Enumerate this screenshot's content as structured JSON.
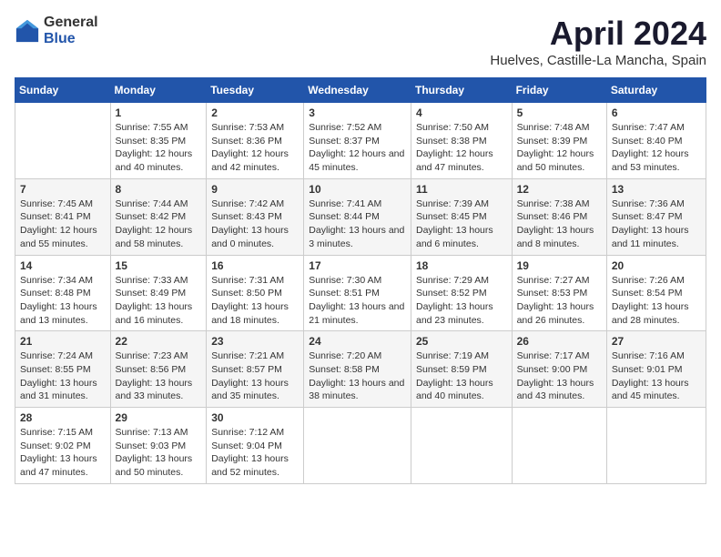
{
  "logo": {
    "general": "General",
    "blue": "Blue"
  },
  "title": "April 2024",
  "location": "Huelves, Castille-La Mancha, Spain",
  "weekdays": [
    "Sunday",
    "Monday",
    "Tuesday",
    "Wednesday",
    "Thursday",
    "Friday",
    "Saturday"
  ],
  "weeks": [
    [
      {
        "day": "",
        "sunrise": "",
        "sunset": "",
        "daylight": ""
      },
      {
        "day": "1",
        "sunrise": "Sunrise: 7:55 AM",
        "sunset": "Sunset: 8:35 PM",
        "daylight": "Daylight: 12 hours and 40 minutes."
      },
      {
        "day": "2",
        "sunrise": "Sunrise: 7:53 AM",
        "sunset": "Sunset: 8:36 PM",
        "daylight": "Daylight: 12 hours and 42 minutes."
      },
      {
        "day": "3",
        "sunrise": "Sunrise: 7:52 AM",
        "sunset": "Sunset: 8:37 PM",
        "daylight": "Daylight: 12 hours and 45 minutes."
      },
      {
        "day": "4",
        "sunrise": "Sunrise: 7:50 AM",
        "sunset": "Sunset: 8:38 PM",
        "daylight": "Daylight: 12 hours and 47 minutes."
      },
      {
        "day": "5",
        "sunrise": "Sunrise: 7:48 AM",
        "sunset": "Sunset: 8:39 PM",
        "daylight": "Daylight: 12 hours and 50 minutes."
      },
      {
        "day": "6",
        "sunrise": "Sunrise: 7:47 AM",
        "sunset": "Sunset: 8:40 PM",
        "daylight": "Daylight: 12 hours and 53 minutes."
      }
    ],
    [
      {
        "day": "7",
        "sunrise": "Sunrise: 7:45 AM",
        "sunset": "Sunset: 8:41 PM",
        "daylight": "Daylight: 12 hours and 55 minutes."
      },
      {
        "day": "8",
        "sunrise": "Sunrise: 7:44 AM",
        "sunset": "Sunset: 8:42 PM",
        "daylight": "Daylight: 12 hours and 58 minutes."
      },
      {
        "day": "9",
        "sunrise": "Sunrise: 7:42 AM",
        "sunset": "Sunset: 8:43 PM",
        "daylight": "Daylight: 13 hours and 0 minutes."
      },
      {
        "day": "10",
        "sunrise": "Sunrise: 7:41 AM",
        "sunset": "Sunset: 8:44 PM",
        "daylight": "Daylight: 13 hours and 3 minutes."
      },
      {
        "day": "11",
        "sunrise": "Sunrise: 7:39 AM",
        "sunset": "Sunset: 8:45 PM",
        "daylight": "Daylight: 13 hours and 6 minutes."
      },
      {
        "day": "12",
        "sunrise": "Sunrise: 7:38 AM",
        "sunset": "Sunset: 8:46 PM",
        "daylight": "Daylight: 13 hours and 8 minutes."
      },
      {
        "day": "13",
        "sunrise": "Sunrise: 7:36 AM",
        "sunset": "Sunset: 8:47 PM",
        "daylight": "Daylight: 13 hours and 11 minutes."
      }
    ],
    [
      {
        "day": "14",
        "sunrise": "Sunrise: 7:34 AM",
        "sunset": "Sunset: 8:48 PM",
        "daylight": "Daylight: 13 hours and 13 minutes."
      },
      {
        "day": "15",
        "sunrise": "Sunrise: 7:33 AM",
        "sunset": "Sunset: 8:49 PM",
        "daylight": "Daylight: 13 hours and 16 minutes."
      },
      {
        "day": "16",
        "sunrise": "Sunrise: 7:31 AM",
        "sunset": "Sunset: 8:50 PM",
        "daylight": "Daylight: 13 hours and 18 minutes."
      },
      {
        "day": "17",
        "sunrise": "Sunrise: 7:30 AM",
        "sunset": "Sunset: 8:51 PM",
        "daylight": "Daylight: 13 hours and 21 minutes."
      },
      {
        "day": "18",
        "sunrise": "Sunrise: 7:29 AM",
        "sunset": "Sunset: 8:52 PM",
        "daylight": "Daylight: 13 hours and 23 minutes."
      },
      {
        "day": "19",
        "sunrise": "Sunrise: 7:27 AM",
        "sunset": "Sunset: 8:53 PM",
        "daylight": "Daylight: 13 hours and 26 minutes."
      },
      {
        "day": "20",
        "sunrise": "Sunrise: 7:26 AM",
        "sunset": "Sunset: 8:54 PM",
        "daylight": "Daylight: 13 hours and 28 minutes."
      }
    ],
    [
      {
        "day": "21",
        "sunrise": "Sunrise: 7:24 AM",
        "sunset": "Sunset: 8:55 PM",
        "daylight": "Daylight: 13 hours and 31 minutes."
      },
      {
        "day": "22",
        "sunrise": "Sunrise: 7:23 AM",
        "sunset": "Sunset: 8:56 PM",
        "daylight": "Daylight: 13 hours and 33 minutes."
      },
      {
        "day": "23",
        "sunrise": "Sunrise: 7:21 AM",
        "sunset": "Sunset: 8:57 PM",
        "daylight": "Daylight: 13 hours and 35 minutes."
      },
      {
        "day": "24",
        "sunrise": "Sunrise: 7:20 AM",
        "sunset": "Sunset: 8:58 PM",
        "daylight": "Daylight: 13 hours and 38 minutes."
      },
      {
        "day": "25",
        "sunrise": "Sunrise: 7:19 AM",
        "sunset": "Sunset: 8:59 PM",
        "daylight": "Daylight: 13 hours and 40 minutes."
      },
      {
        "day": "26",
        "sunrise": "Sunrise: 7:17 AM",
        "sunset": "Sunset: 9:00 PM",
        "daylight": "Daylight: 13 hours and 43 minutes."
      },
      {
        "day": "27",
        "sunrise": "Sunrise: 7:16 AM",
        "sunset": "Sunset: 9:01 PM",
        "daylight": "Daylight: 13 hours and 45 minutes."
      }
    ],
    [
      {
        "day": "28",
        "sunrise": "Sunrise: 7:15 AM",
        "sunset": "Sunset: 9:02 PM",
        "daylight": "Daylight: 13 hours and 47 minutes."
      },
      {
        "day": "29",
        "sunrise": "Sunrise: 7:13 AM",
        "sunset": "Sunset: 9:03 PM",
        "daylight": "Daylight: 13 hours and 50 minutes."
      },
      {
        "day": "30",
        "sunrise": "Sunrise: 7:12 AM",
        "sunset": "Sunset: 9:04 PM",
        "daylight": "Daylight: 13 hours and 52 minutes."
      },
      {
        "day": "",
        "sunrise": "",
        "sunset": "",
        "daylight": ""
      },
      {
        "day": "",
        "sunrise": "",
        "sunset": "",
        "daylight": ""
      },
      {
        "day": "",
        "sunrise": "",
        "sunset": "",
        "daylight": ""
      },
      {
        "day": "",
        "sunrise": "",
        "sunset": "",
        "daylight": ""
      }
    ]
  ]
}
